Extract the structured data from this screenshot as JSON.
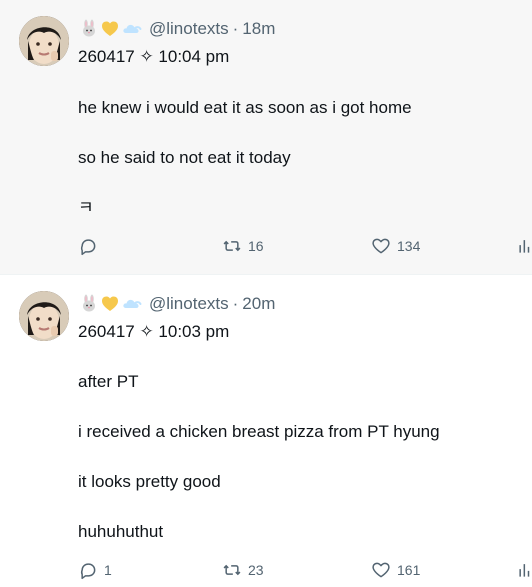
{
  "tweets": [
    {
      "handle": "@linotexts",
      "separator": "·",
      "time_ago": "18m",
      "date_line": "260417 ✧ 10:04 pm",
      "lines": [
        "he knew i would eat it as soon as i got home",
        "so he said to not eat it today",
        "ㅋ"
      ],
      "reply_count": "",
      "retweet_count": "16",
      "like_count": "134"
    },
    {
      "handle": "@linotexts",
      "separator": "·",
      "time_ago": "20m",
      "date_line": "260417 ✧ 10:03 pm",
      "lines": [
        "after PT",
        "i received a chicken breast pizza from PT hyung",
        "it looks pretty good",
        "huhuhuthut"
      ],
      "reply_count": "1",
      "retweet_count": "23",
      "like_count": "161"
    }
  ],
  "icons": {
    "emoji_1": "rabbit-icon",
    "emoji_2": "yellow-heart-icon",
    "emoji_3": "cloud-icon",
    "reply": "reply-icon",
    "retweet": "retweet-icon",
    "like": "heart-icon",
    "views": "views-icon"
  },
  "colors": {
    "text": "#0f1419",
    "muted": "#536471",
    "first_bg": "#f7f7f7",
    "second_bg": "#ffffff"
  }
}
